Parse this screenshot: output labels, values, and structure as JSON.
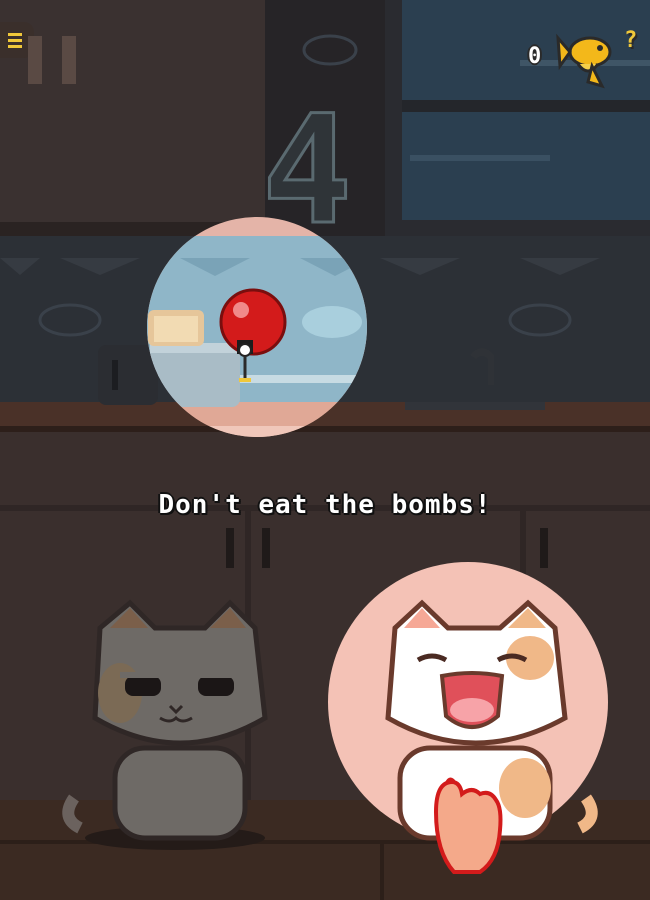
{
  "game": {
    "fish_count": "0",
    "help_label": "?",
    "countdown": "4",
    "hint_text": "Don't eat the bombs!"
  },
  "icons": {
    "menu": "menu-icon",
    "pause": "pause-icon",
    "currency": "goldfish-icon",
    "bomb": "bomb-icon",
    "tap_hand": "pointing-hand-icon"
  },
  "colors": {
    "accent_gold": "#f0c83a",
    "bomb_red": "#d01a1a",
    "spotlight": "#f4c2b6",
    "wall": "#3a3130",
    "window": "#2a3a48"
  }
}
